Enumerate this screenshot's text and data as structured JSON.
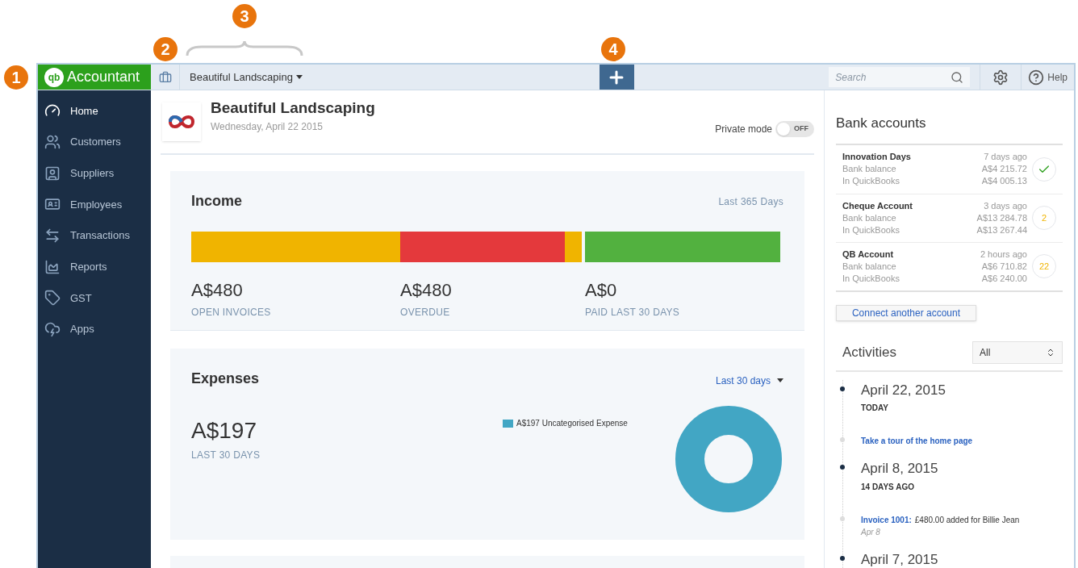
{
  "markers": [
    {
      "text": "1"
    },
    {
      "text": "2"
    },
    {
      "text": "3"
    },
    {
      "text": "4"
    }
  ],
  "brand": {
    "logo": "qb",
    "name": "Accountant"
  },
  "toolbar": {
    "company": "Beautiful Landscaping",
    "search": {
      "placeholder": "Search"
    },
    "help": "Help"
  },
  "sidebar": {
    "items": [
      {
        "label": "Home",
        "selected": true
      },
      {
        "label": "Customers",
        "selected": false
      },
      {
        "label": "Suppliers",
        "selected": false
      },
      {
        "label": "Employees",
        "selected": false
      },
      {
        "label": "Transactions",
        "selected": false
      },
      {
        "label": "Reports",
        "selected": false
      },
      {
        "label": "GST",
        "selected": false
      },
      {
        "label": "Apps",
        "selected": false
      }
    ]
  },
  "company_header": {
    "name": "Beautiful Landscaping",
    "date": "Wednesday, April 22 2015",
    "private_mode": {
      "label": "Private mode",
      "on": false,
      "state_text": "OFF"
    }
  },
  "income": {
    "title": "Income",
    "period": "Last 365 Days",
    "stats": [
      {
        "amount": "A$480",
        "label": "OPEN INVOICES"
      },
      {
        "amount": "A$480",
        "label": "OVERDUE"
      },
      {
        "amount": "A$0",
        "label": "PAID LAST 30 DAYS"
      }
    ]
  },
  "expenses": {
    "title": "Expenses",
    "period": "Last 30 days",
    "amount": "A$197",
    "amount_label": "LAST 30 DAYS",
    "legend": [
      {
        "label": "A$197 Uncategorised Expense",
        "color": "#42a6c4"
      }
    ]
  },
  "bank_accounts": {
    "title": "Bank accounts",
    "accounts": [
      {
        "name": "Innovation Days",
        "updated": "7 days ago",
        "bank_label": "Bank balance",
        "bank_balance": "A$4 215.72",
        "qb_label": "In QuickBooks",
        "qb_balance": "A$4 005.13",
        "badge": {
          "kind": "check"
        }
      },
      {
        "name": "Cheque Account",
        "updated": "3 days ago",
        "bank_label": "Bank balance",
        "bank_balance": "A$13 284.78",
        "qb_label": "In QuickBooks",
        "qb_balance": "A$13 267.44",
        "badge": {
          "kind": "count",
          "text": "2"
        }
      },
      {
        "name": "QB Account",
        "updated": "2 hours ago",
        "bank_label": "Bank balance",
        "bank_balance": "A$6 710.82",
        "qb_label": "In QuickBooks",
        "qb_balance": "A$6 240.00",
        "badge": {
          "kind": "count",
          "text": "22"
        }
      }
    ],
    "connect_button": "Connect another account"
  },
  "activities": {
    "title": "Activities",
    "filter": "All",
    "groups": [
      {
        "date": "April 22, 2015",
        "ago": "TODAY",
        "entries": [
          {
            "kind": "link",
            "text": "Take a tour of the home page"
          }
        ]
      },
      {
        "date": "April 8, 2015",
        "ago": "14 DAYS AGO",
        "entries": [
          {
            "kind": "invoice",
            "link": "Invoice 1001:",
            "text": "£480.00 added for Billie Jean",
            "date": "Apr 8"
          }
        ]
      },
      {
        "date": "April 7, 2015"
      }
    ]
  }
}
